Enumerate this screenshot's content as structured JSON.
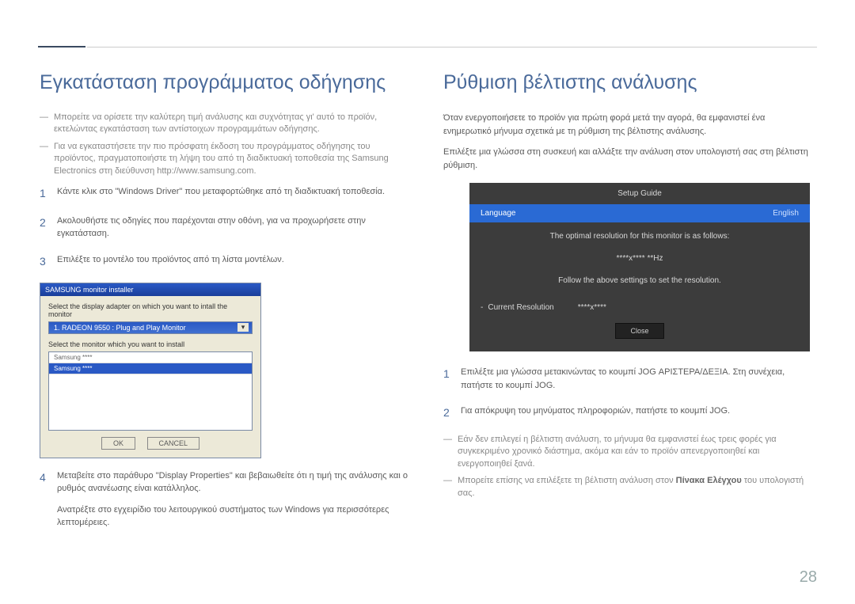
{
  "page_number": "28",
  "left": {
    "heading": "Εγκατάσταση προγράμματος οδήγησης",
    "notes": [
      "Μπορείτε να ορίσετε την καλύτερη τιμή ανάλυσης και συχνότητας γι' αυτό το προϊόν, εκτελώντας εγκατάσταση των αντίστοιχων προγραμμάτων οδήγησης.",
      "Για να εγκαταστήσετε την πιο πρόσφατη έκδοση του προγράμματος οδήγησης του προϊόντος, πραγματοποιήστε τη λήψη του από τη διαδικτυακή τοποθεσία της Samsung Electronics στη διεύθυνση http://www.samsung.com."
    ],
    "steps": [
      "Κάντε κλικ στο \"Windows Driver\" που μεταφορτώθηκε από τη διαδικτυακή τοποθεσία.",
      "Ακολουθήστε τις οδηγίες που παρέχονται στην οθόνη, για να προχωρήσετε στην εγκατάσταση.",
      "Επιλέξτε το μοντέλο του προϊόντος από τη λίστα μοντέλων."
    ],
    "step4": "Μεταβείτε στο παράθυρο \"Display Properties\" και βεβαιωθείτε ότι η τιμή της ανάλυσης και ο ρυθμός ανανέωσης είναι κατάλληλος.",
    "step4_sub": "Ανατρέξτε στο εγχειρίδιο του λειτουργικού συστήματος των Windows για περισσότερες λεπτομέρειες.",
    "installer": {
      "title": "SAMSUNG monitor installer",
      "label1": "Select the display adapter on which you want to intall the monitor",
      "adapter": "1. RADEON 9550 : Plug and Play Monitor",
      "label2": "Select the monitor which you want to install",
      "row1": "Samsung ****",
      "row2": "Samsung ****",
      "ok": "OK",
      "cancel": "CANCEL"
    }
  },
  "right": {
    "heading": "Ρύθμιση βέλτιστης ανάλυσης",
    "intro1": "Όταν ενεργοποιήσετε το προϊόν για πρώτη φορά μετά την αγορά, θα εμφανιστεί ένα ενημερωτικό μήνυμα σχετικά με τη ρύθμιση της βέλτιστης ανάλυσης.",
    "intro2": "Επιλέξτε μια γλώσσα στη συσκευή και αλλάξτε την ανάλυση στον υπολογιστή σας στη βέλτιστη ρύθμιση.",
    "setup": {
      "title": "Setup Guide",
      "lang_label": "Language",
      "lang_value": "English",
      "line1": "The optimal resolution for this monitor is as follows:",
      "line2": "****x**** **Hz",
      "line3": "Follow the above settings to set the resolution.",
      "cur_label": "Current Resolution",
      "cur_value": "****x****",
      "close": "Close"
    },
    "steps": [
      "Επιλέξτε μια γλώσσα μετακινώντας το κουμπί JOG ΑΡΙΣΤΕΡΑ/ΔΕΞΙΑ. Στη συνέχεια, πατήστε το κουμπί JOG.",
      "Για απόκρυψη του μηνύματος πληροφοριών, πατήστε το κουμπί JOG."
    ],
    "notes": [
      "Εάν δεν επιλεγεί η βέλτιστη ανάλυση, το μήνυμα θα εμφανιστεί έως τρεις φορές για συγκεκριμένο χρονικό διάστημα, ακόμα και εάν το προϊόν απενεργοποιηθεί και ενεργοποιηθεί ξανά."
    ],
    "note2_pre": "Μπορείτε επίσης να επιλέξετε τη βέλτιστη ανάλυση στον ",
    "note2_bold": "Πίνακα Ελέγχου",
    "note2_post": " του υπολογιστή σας."
  }
}
